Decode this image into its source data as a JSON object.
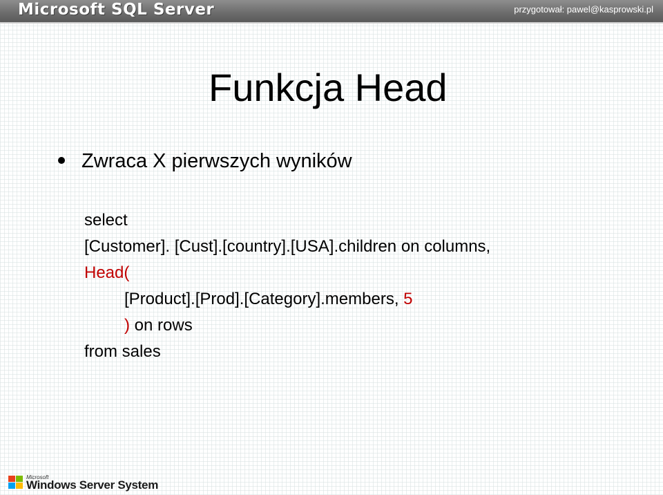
{
  "header": {
    "logo_text": "Microsoft SQL Server",
    "author": "przygotował: pawel@kasprowski.pl"
  },
  "slide": {
    "title": "Funkcja Head",
    "bullet": "Zwraca X pierwszych wyników",
    "code": {
      "line1": "select",
      "line2": "[Customer]. [Cust].[country].[USA].children on columns,",
      "line3_head": "Head(",
      "line4_member": "[Product].[Prod].[Category].members, ",
      "line4_count": "5",
      "line5_paren": ")",
      "line5_rest": " on rows",
      "line6": "from sales"
    }
  },
  "footer": {
    "microsoft_label": "Microsoft",
    "product_name": "Windows Server System"
  },
  "colors": {
    "header_bg": "#6e6e6e",
    "accent_red": "#c00000"
  }
}
